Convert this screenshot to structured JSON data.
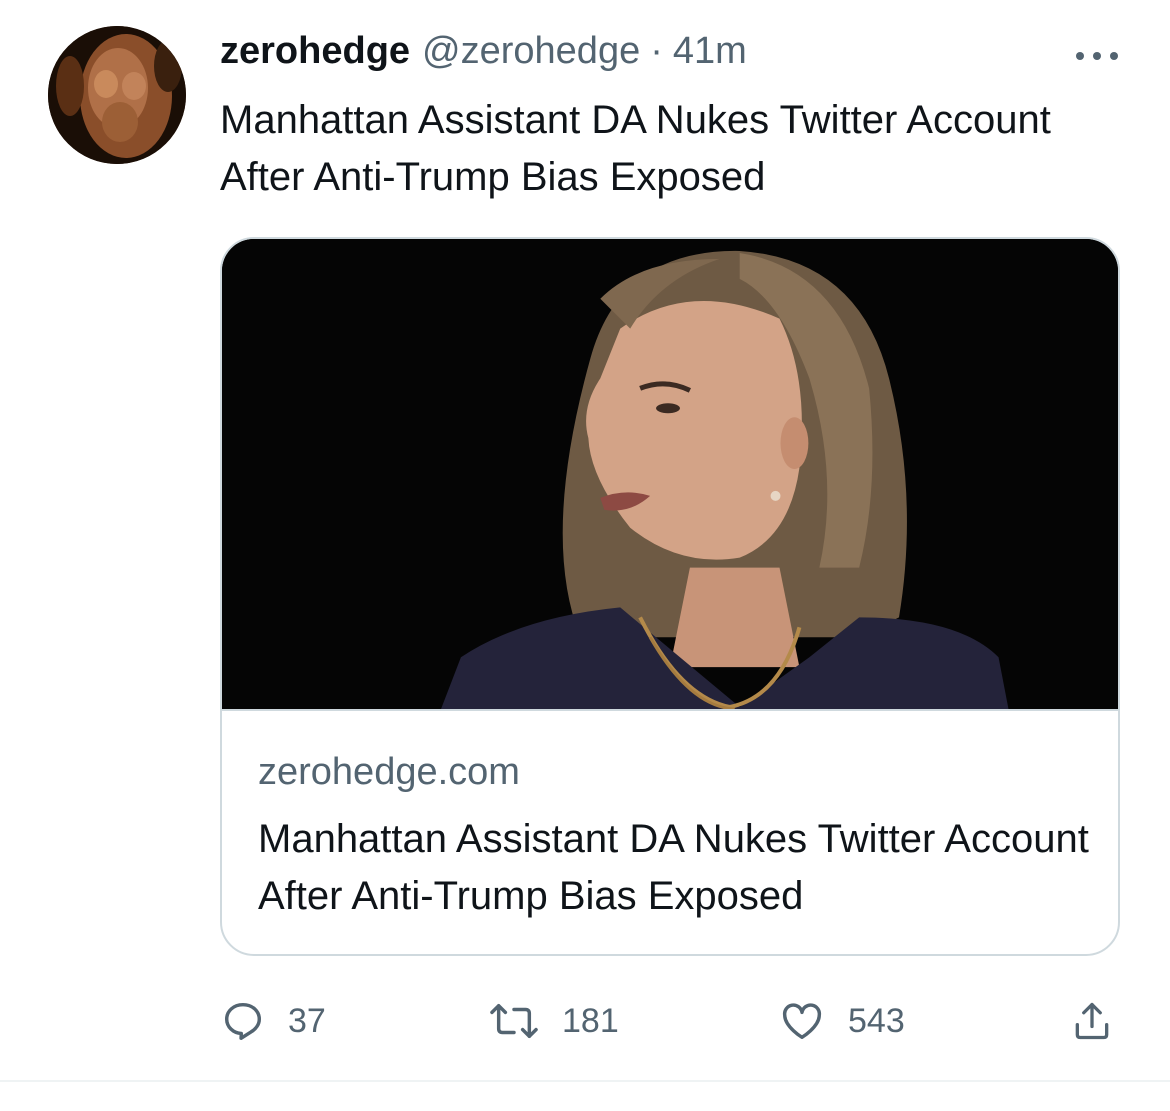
{
  "tweet": {
    "display_name": "zerohedge",
    "handle": "@zerohedge",
    "separator": "·",
    "time": "41m",
    "text": "Manhattan Assistant DA Nukes Twitter Account After Anti-Trump Bias Exposed"
  },
  "card": {
    "domain": "zerohedge.com",
    "title": "Manhattan Assistant DA Nukes Twitter Account After Anti-Trump Bias Exposed"
  },
  "actions": {
    "replies": "37",
    "retweets": "181",
    "likes": "543"
  },
  "icons": {
    "more": "more-horizontal-icon",
    "reply": "reply-bubble-icon",
    "retweet": "retweet-arrows-icon",
    "like": "heart-icon",
    "share": "share-upload-icon"
  },
  "colors": {
    "text": "#0f1419",
    "secondary": "#536471",
    "border": "#cfd9de"
  }
}
